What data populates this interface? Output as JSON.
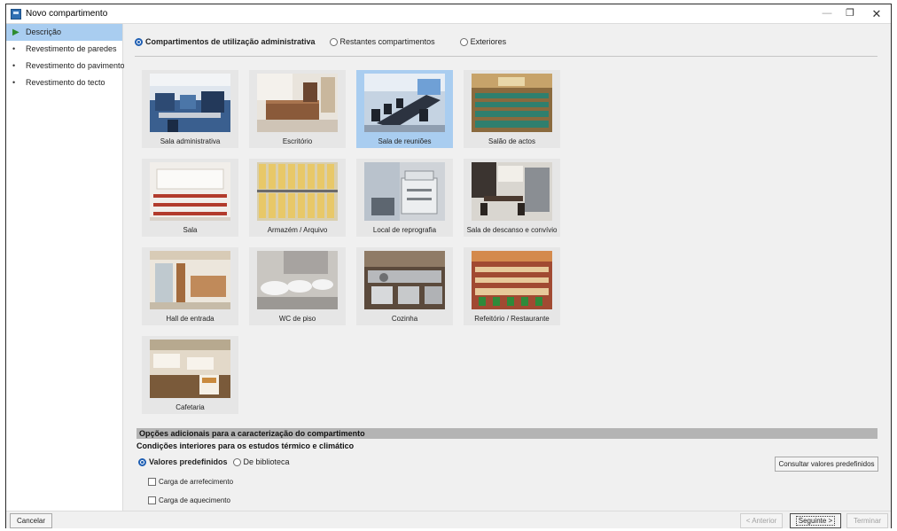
{
  "window": {
    "title": "Novo compartimento",
    "controls": {
      "minimize": "—",
      "maximize": "❐",
      "close": "✕"
    }
  },
  "sidebar": {
    "items": [
      {
        "label": "Descrição",
        "active": true
      },
      {
        "label": "Revestimento de paredes",
        "active": false
      },
      {
        "label": "Revestimento do pavimento",
        "active": false
      },
      {
        "label": "Revestimento do tecto",
        "active": false
      }
    ]
  },
  "categories": {
    "options": [
      {
        "label": "Compartimentos de utilização administrativa",
        "checked": true
      },
      {
        "label": "Restantes compartimentos",
        "checked": false
      },
      {
        "label": "Exteriores",
        "checked": false
      }
    ]
  },
  "rooms": [
    {
      "label": "Sala administrativa",
      "selected": false
    },
    {
      "label": "Escritório",
      "selected": false
    },
    {
      "label": "Sala de reuniões",
      "selected": true
    },
    {
      "label": "Salão de actos",
      "selected": false
    },
    {
      "label": "Sala",
      "selected": false
    },
    {
      "label": "Armazém / Arquivo",
      "selected": false
    },
    {
      "label": "Local de reprografia",
      "selected": false
    },
    {
      "label": "Sala de descanso e convívio",
      "selected": false
    },
    {
      "label": "Hall de entrada",
      "selected": false
    },
    {
      "label": "WC de piso",
      "selected": false
    },
    {
      "label": "Cozinha",
      "selected": false
    },
    {
      "label": "Refeitório / Restaurante",
      "selected": false
    },
    {
      "label": "Cafetaria",
      "selected": false
    }
  ],
  "options": {
    "header": "Opções adicionais para a caracterização do compartimento",
    "subheader": "Condições interiores para os estudos térmico e climático",
    "source": [
      {
        "label": "Valores predefinidos",
        "checked": true
      },
      {
        "label": "De biblioteca",
        "checked": false
      }
    ],
    "consult_button": "Consultar valores predefinidos",
    "checks": [
      {
        "label": "Carga de arrefecimento",
        "checked": false
      },
      {
        "label": "Carga de aquecimento",
        "checked": false
      }
    ]
  },
  "footer": {
    "cancel": "Cancelar",
    "previous": "< Anterior",
    "next": "Seguinte >",
    "finish": "Terminar"
  },
  "colors": {
    "selection": "#a9cdf0",
    "radio_accent": "#1f5fb3",
    "active_marker": "#2e8b2e"
  }
}
